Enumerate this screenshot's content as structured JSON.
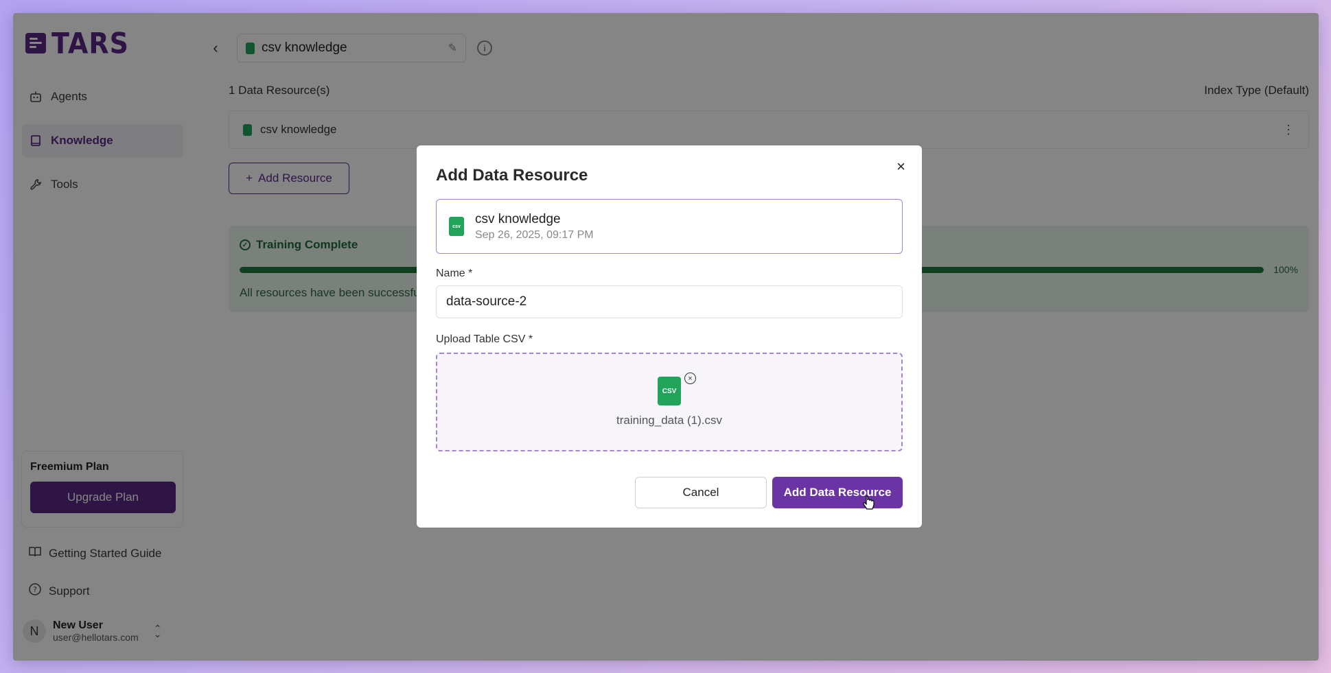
{
  "app": {
    "logo_text": "TARS"
  },
  "sidebar": {
    "items": [
      {
        "label": "Agents",
        "icon": "robot-icon"
      },
      {
        "label": "Knowledge",
        "icon": "book-icon",
        "active": true
      },
      {
        "label": "Tools",
        "icon": "wrench-icon"
      }
    ],
    "plan_title": "Freemium Plan",
    "upgrade_label": "Upgrade Plan",
    "guide_label": "Getting Started Guide",
    "support_label": "Support",
    "user": {
      "initial": "N",
      "name": "New User",
      "email": "user@hellotars.com"
    }
  },
  "main": {
    "knowledge_title": "csv knowledge",
    "resource_count": "1 Data Resource(s)",
    "index_type": "Index Type (Default)",
    "resources": [
      {
        "name": "csv knowledge"
      }
    ],
    "add_resource_label": "Add Resource",
    "training": {
      "title": "Training Complete",
      "progress": 100,
      "progress_label": "100%",
      "message": "All resources have been successfu"
    }
  },
  "modal": {
    "title": "Add Data Resource",
    "selected": {
      "name": "csv knowledge",
      "date": "Sep 26, 2025, 09:17 PM",
      "icon_label": "csv"
    },
    "name_label": "Name *",
    "name_value": "data-source-2",
    "upload_label": "Upload Table CSV *",
    "file_icon_label": "CSV",
    "file_name": "training_data (1).csv",
    "cancel_label": "Cancel",
    "submit_label": "Add Data Resource"
  },
  "colors": {
    "brand": "#5b2a86",
    "primary_button": "#6a34a4",
    "success": "#1e7a3d",
    "csv_icon": "#21a35a"
  }
}
